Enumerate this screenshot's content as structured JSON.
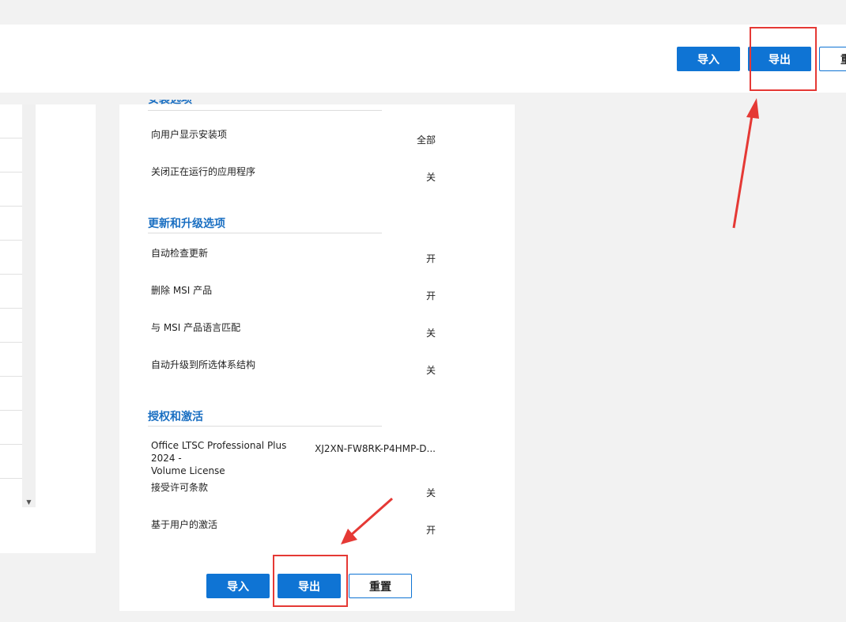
{
  "toolbar": {
    "import_label": "导入",
    "export_label": "导出",
    "reset_label_partial": "重"
  },
  "sections": {
    "install": {
      "title": "安装选项",
      "items": [
        {
          "label": "向用户显示安装项",
          "value": "全部"
        },
        {
          "label": "关闭正在运行的应用程序",
          "value": "关"
        }
      ]
    },
    "update": {
      "title": "更新和升级选项",
      "items": [
        {
          "label": "自动检查更新",
          "value": "开"
        },
        {
          "label": "删除 MSI 产品",
          "value": "开"
        },
        {
          "label": "与 MSI 产品语言匹配",
          "value": "关"
        },
        {
          "label": "自动升级到所选体系结构",
          "value": "关"
        }
      ]
    },
    "licensing": {
      "title": "授权和激活",
      "product_line1": "Office LTSC Professional Plus 2024 -",
      "product_line2": "Volume License",
      "product_key": "XJ2XN-FW8RK-P4HMP-D...",
      "items": [
        {
          "label": "接受许可条款",
          "value": "关"
        },
        {
          "label": "基于用户的激活",
          "value": "开"
        }
      ]
    }
  },
  "footer": {
    "import_label": "导入",
    "export_label": "导出",
    "reset_label": "重置"
  },
  "colors": {
    "accent": "#0f74d4",
    "section_title": "#1a6fc2",
    "highlight": "#e53935"
  }
}
